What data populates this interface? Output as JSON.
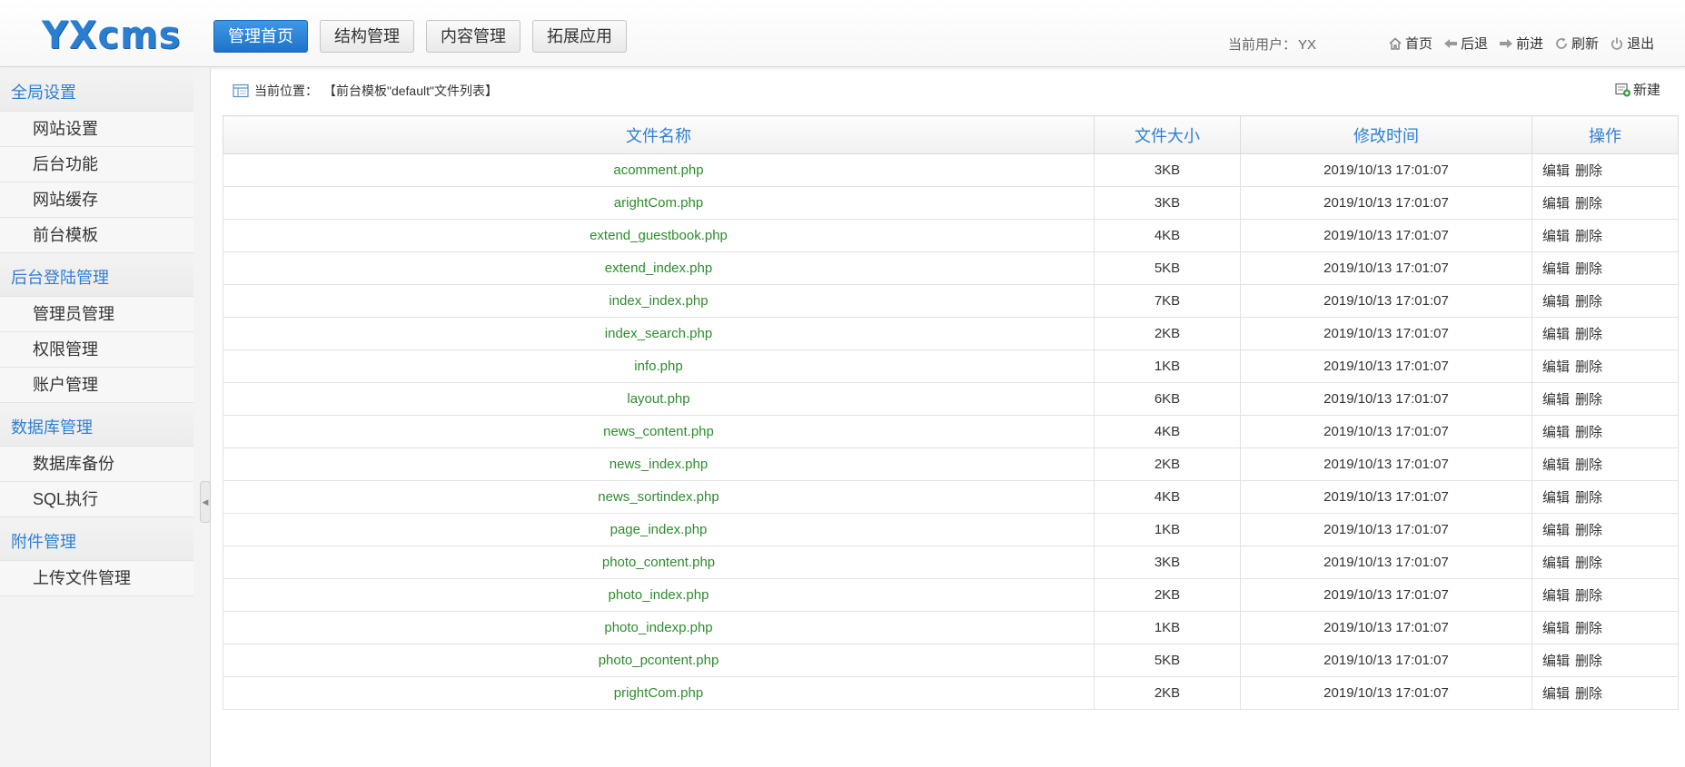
{
  "header": {
    "logo": "YXcms",
    "nav": [
      {
        "label": "管理首页",
        "active": true
      },
      {
        "label": "结构管理",
        "active": false
      },
      {
        "label": "内容管理",
        "active": false
      },
      {
        "label": "拓展应用",
        "active": false
      }
    ],
    "user_label": "当前用户：",
    "user_name": "YX",
    "quick_links": [
      {
        "label": "首页",
        "icon": "home-icon"
      },
      {
        "label": "后退",
        "icon": "back-arrow-icon"
      },
      {
        "label": "前进",
        "icon": "forward-arrow-icon"
      },
      {
        "label": "刷新",
        "icon": "refresh-icon"
      },
      {
        "label": "退出",
        "icon": "logout-icon"
      }
    ]
  },
  "sidebar": {
    "groups": [
      {
        "title": "全局设置",
        "items": [
          "网站设置",
          "后台功能",
          "网站缓存",
          "前台模板"
        ]
      },
      {
        "title": "后台登陆管理",
        "items": [
          "管理员管理",
          "权限管理",
          "账户管理"
        ]
      },
      {
        "title": "数据库管理",
        "items": [
          "数据库备份",
          "SQL执行"
        ]
      },
      {
        "title": "附件管理",
        "items": [
          "上传文件管理"
        ]
      }
    ]
  },
  "main": {
    "breadcrumb_label": "当前位置：",
    "breadcrumb_value": "【前台模板\"default\"文件列表】",
    "new_label": "新建",
    "columns": [
      "文件名称",
      "文件大小",
      "修改时间",
      "操作"
    ],
    "edit_label": "编辑",
    "delete_label": "删除",
    "rows": [
      {
        "name": "acomment.php",
        "size": "3KB",
        "time": "2019/10/13 17:01:07"
      },
      {
        "name": "arightCom.php",
        "size": "3KB",
        "time": "2019/10/13 17:01:07"
      },
      {
        "name": "extend_guestbook.php",
        "size": "4KB",
        "time": "2019/10/13 17:01:07"
      },
      {
        "name": "extend_index.php",
        "size": "5KB",
        "time": "2019/10/13 17:01:07"
      },
      {
        "name": "index_index.php",
        "size": "7KB",
        "time": "2019/10/13 17:01:07"
      },
      {
        "name": "index_search.php",
        "size": "2KB",
        "time": "2019/10/13 17:01:07"
      },
      {
        "name": "info.php",
        "size": "1KB",
        "time": "2019/10/13 17:01:07"
      },
      {
        "name": "layout.php",
        "size": "6KB",
        "time": "2019/10/13 17:01:07"
      },
      {
        "name": "news_content.php",
        "size": "4KB",
        "time": "2019/10/13 17:01:07"
      },
      {
        "name": "news_index.php",
        "size": "2KB",
        "time": "2019/10/13 17:01:07"
      },
      {
        "name": "news_sortindex.php",
        "size": "4KB",
        "time": "2019/10/13 17:01:07"
      },
      {
        "name": "page_index.php",
        "size": "1KB",
        "time": "2019/10/13 17:01:07"
      },
      {
        "name": "photo_content.php",
        "size": "3KB",
        "time": "2019/10/13 17:01:07"
      },
      {
        "name": "photo_index.php",
        "size": "2KB",
        "time": "2019/10/13 17:01:07"
      },
      {
        "name": "photo_indexp.php",
        "size": "1KB",
        "time": "2019/10/13 17:01:07"
      },
      {
        "name": "photo_pcontent.php",
        "size": "5KB",
        "time": "2019/10/13 17:01:07"
      },
      {
        "name": "prightCom.php",
        "size": "2KB",
        "time": "2019/10/13 17:01:07"
      }
    ]
  },
  "colors": {
    "accent": "#2f7fd1",
    "active_button": "#1f73c9",
    "file_name": "#2e8b2e"
  }
}
